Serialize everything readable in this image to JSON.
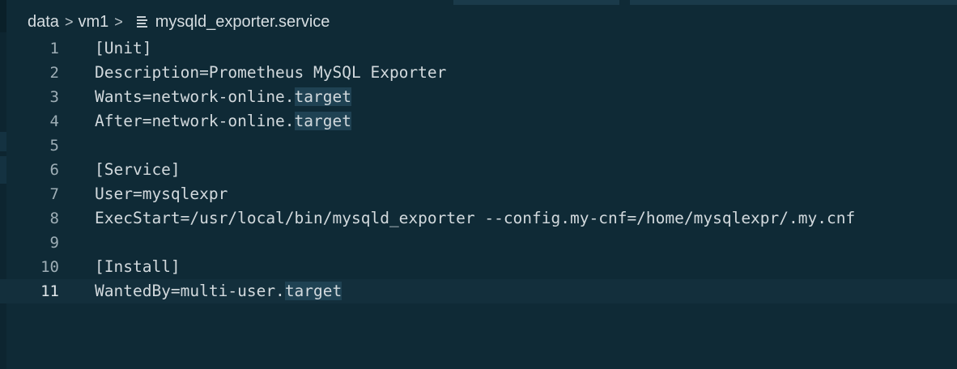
{
  "breadcrumb": {
    "items": [
      "data",
      "vm1",
      "mysqld_exporter.service"
    ],
    "separator": ">"
  },
  "editor": {
    "current_line": 11,
    "highlight_word": "target",
    "lines": [
      {
        "number": "1",
        "text": "[Unit]"
      },
      {
        "number": "2",
        "text": "Description=Prometheus MySQL Exporter"
      },
      {
        "number": "3",
        "text": "Wants=network-online.target"
      },
      {
        "number": "4",
        "text": "After=network-online.target"
      },
      {
        "number": "5",
        "text": ""
      },
      {
        "number": "6",
        "text": "[Service]"
      },
      {
        "number": "7",
        "text": "User=mysqlexpr"
      },
      {
        "number": "8",
        "text": "ExecStart=/usr/local/bin/mysqld_exporter --config.my-cnf=/home/mysqlexpr/.my.cnf"
      },
      {
        "number": "9",
        "text": ""
      },
      {
        "number": "10",
        "text": "[Install]"
      },
      {
        "number": "11",
        "text": "WantedBy=multi-user.target"
      }
    ]
  },
  "colors": {
    "background": "#0f2a36",
    "text": "#d2d9dd",
    "line_number": "#9eaeb6",
    "word_highlight": "#1f4253",
    "current_line": "#132f3c"
  },
  "icons": {
    "file": "file-lines-icon",
    "separator": "chevron-right-icon"
  }
}
